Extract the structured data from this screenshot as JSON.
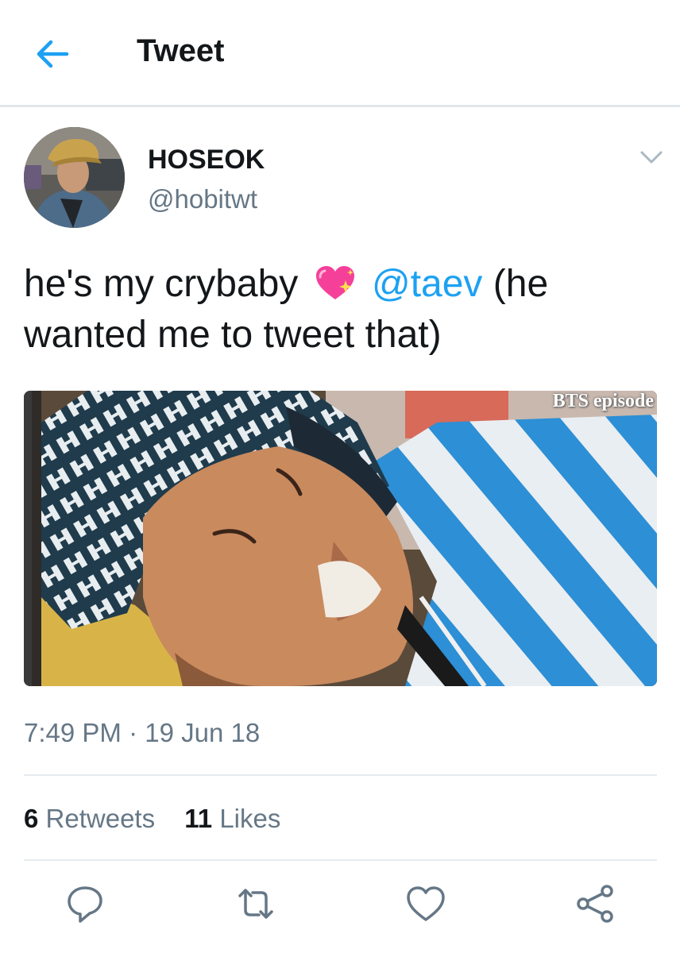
{
  "header": {
    "title": "Tweet",
    "back_icon": "back-arrow-icon"
  },
  "tweet": {
    "author": {
      "display_name": "HOSEOK",
      "handle": "@hobitwt"
    },
    "text_before": "he's my crybaby",
    "emoji": "sparkling-heart",
    "mention": "@taev",
    "text_after": "(he wanted me to tweet that)",
    "media_watermark": "BTS episode",
    "timestamp": "7:49 PM · 19 Jun 18",
    "stats": {
      "retweets_count": "6",
      "retweets_label": "Retweets",
      "likes_count": "11",
      "likes_label": "Likes"
    },
    "actions": [
      "reply-icon",
      "retweet-icon",
      "like-icon",
      "share-icon"
    ]
  },
  "colors": {
    "accent": "#1da1f2",
    "secondary_text": "#657786",
    "primary_text": "#14171a",
    "divider": "#e6ecf0"
  }
}
